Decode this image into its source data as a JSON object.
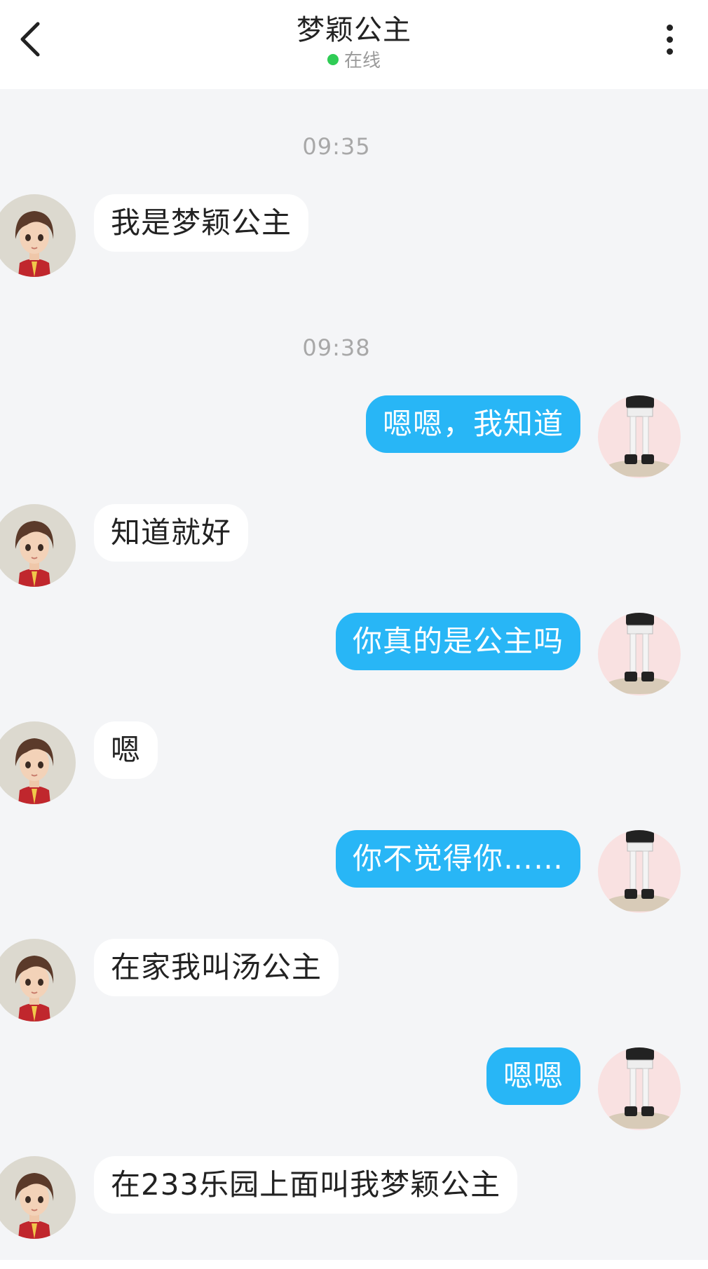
{
  "header": {
    "title": "梦颖公主",
    "status": "在线",
    "status_color": "#2fcc55",
    "back_icon": "chevron-left-icon",
    "more_icon": "more-vertical-icon"
  },
  "colors": {
    "background": "#f4f5f7",
    "outgoing_bubble": "#28b6f6",
    "incoming_bubble": "#ffffff"
  },
  "messages": [
    {
      "type": "time",
      "text": "09:35"
    },
    {
      "type": "in",
      "text": "我是梦颖公主"
    },
    {
      "type": "time",
      "text": "09:38"
    },
    {
      "type": "out",
      "text": "嗯嗯，我知道"
    },
    {
      "type": "in",
      "text": "知道就好"
    },
    {
      "type": "out",
      "text": "你真的是公主吗"
    },
    {
      "type": "in",
      "text": "嗯"
    },
    {
      "type": "out",
      "text": "你不觉得你……"
    },
    {
      "type": "in",
      "text": "在家我叫汤公主"
    },
    {
      "type": "out",
      "text": "嗯嗯"
    },
    {
      "type": "in",
      "text": "在233乐园上面叫我梦颖公主"
    }
  ]
}
